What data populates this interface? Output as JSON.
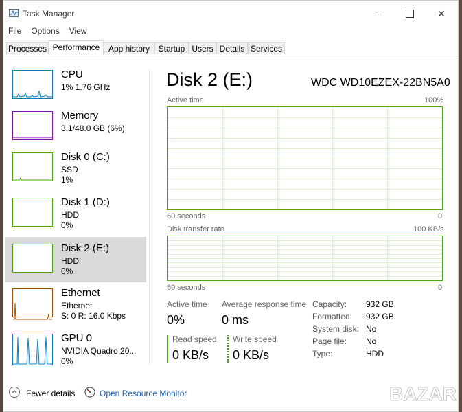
{
  "window": {
    "title": "Task Manager"
  },
  "menu": {
    "file": "File",
    "options": "Options",
    "view": "View"
  },
  "tabs": [
    {
      "label": "Processes",
      "active": false
    },
    {
      "label": "Performance",
      "active": true
    },
    {
      "label": "App history",
      "active": false
    },
    {
      "label": "Startup",
      "active": false
    },
    {
      "label": "Users",
      "active": false
    },
    {
      "label": "Details",
      "active": false
    },
    {
      "label": "Services",
      "active": false
    }
  ],
  "devices": [
    {
      "name": "CPU",
      "line1": "1% 1.76 GHz",
      "line2": "",
      "color": "#117dbb"
    },
    {
      "name": "Memory",
      "line1": "3.1/48.0 GB (6%)",
      "line2": "",
      "color": "#8b12ae"
    },
    {
      "name": "Disk 0 (C:)",
      "line1": "SSD",
      "line2": "1%",
      "color": "#4da60c"
    },
    {
      "name": "Disk 1 (D:)",
      "line1": "HDD",
      "line2": "0%",
      "color": "#4da60c"
    },
    {
      "name": "Disk 2 (E:)",
      "line1": "HDD",
      "line2": "0%",
      "color": "#4da60c",
      "selected": true
    },
    {
      "name": "Ethernet",
      "line1": "Ethernet",
      "line2": "S: 0 R: 16.0 Kbps",
      "color": "#a74f01"
    },
    {
      "name": "GPU 0",
      "line1": "NVIDIA Quadro 20...",
      "line2": "0%",
      "color": "#117dbb"
    }
  ],
  "main": {
    "title": "Disk 2 (E:)",
    "model": "WDC WD10EZEX-22BN5A0",
    "active_time_graph": {
      "label": "Active time",
      "max": "100%",
      "time_label": "60 seconds",
      "min": "0"
    },
    "transfer_graph": {
      "label": "Disk transfer rate",
      "max": "100 KB/s",
      "time_label": "60 seconds",
      "min": "0"
    },
    "stats": {
      "active_time_label": "Active time",
      "active_time_value": "0%",
      "avg_response_label": "Average response time",
      "avg_response_value": "0 ms",
      "read_label": "Read speed",
      "read_value": "0 KB/s",
      "write_label": "Write speed",
      "write_value": "0 KB/s"
    },
    "properties": [
      {
        "key": "Capacity:",
        "value": "932 GB"
      },
      {
        "key": "Formatted:",
        "value": "932 GB"
      },
      {
        "key": "System disk:",
        "value": "No"
      },
      {
        "key": "Page file:",
        "value": "No"
      },
      {
        "key": "Type:",
        "value": "HDD"
      }
    ],
    "accent": "#4da60c"
  },
  "footer": {
    "fewer_details": "Fewer details",
    "open_monitor": "Open Resource Monitor"
  },
  "watermark": "BAZAR"
}
